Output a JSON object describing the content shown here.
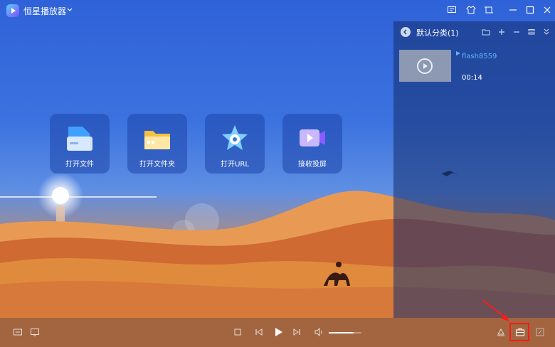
{
  "window": {
    "title": "恒星播放器"
  },
  "titlebar_icons": [
    "feedback-icon",
    "skin-icon",
    "mini-mode-icon",
    "minimize-icon",
    "maximize-icon",
    "close-icon"
  ],
  "playlist": {
    "title": "默认分类(1)",
    "items": [
      {
        "name": "flash8559",
        "duration": "00:14"
      }
    ]
  },
  "quick_actions": [
    {
      "label": "打开文件",
      "icon": "file-icon"
    },
    {
      "label": "打开文件夹",
      "icon": "folder-icon"
    },
    {
      "label": "打开URL",
      "icon": "url-star-icon"
    },
    {
      "label": "接收投屏",
      "icon": "cast-receive-icon"
    }
  ],
  "controls": {
    "volume": 0.75
  },
  "colors": {
    "accent": "#5fb6ff",
    "highlight": "#ff1a1a"
  }
}
